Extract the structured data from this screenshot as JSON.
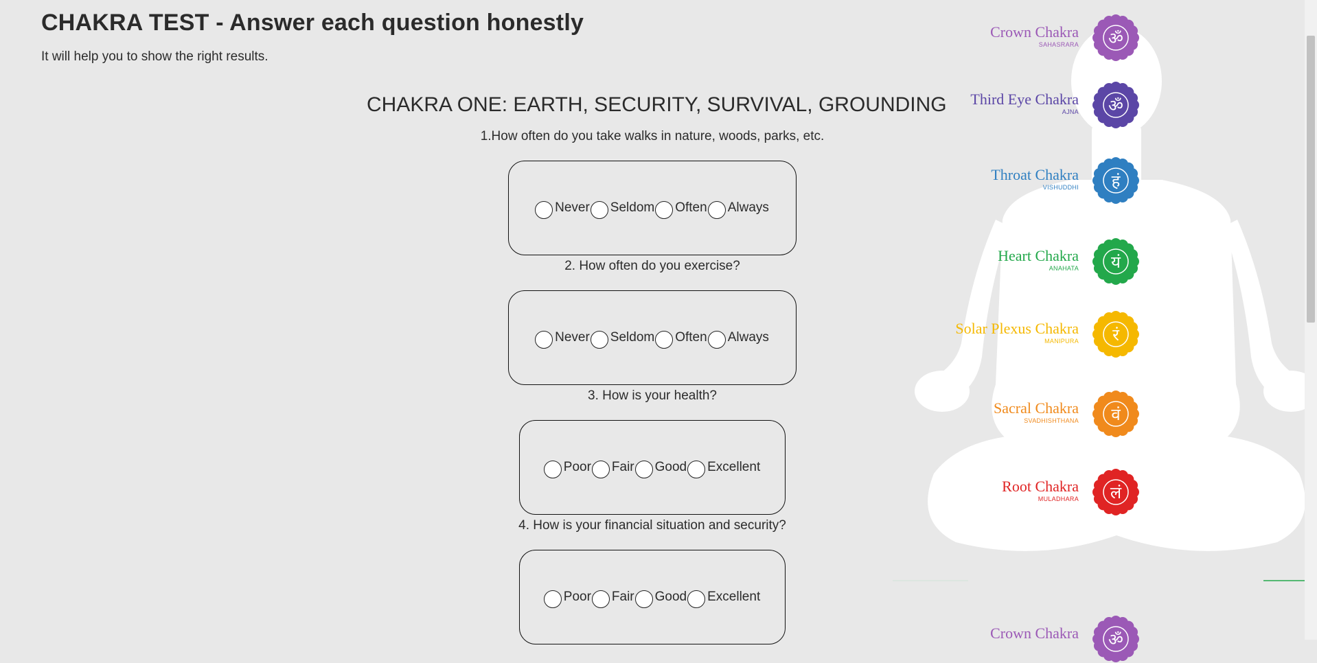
{
  "header": {
    "title": "CHAKRA TEST - Answer each question honestly",
    "subtitle": "It will help you to show the right results."
  },
  "section": {
    "title": "CHAKRA ONE: EARTH, SECURITY, SURVIVAL, GROUNDING"
  },
  "questions": [
    {
      "text": "1.How often do you take walks in nature, woods, parks, etc.",
      "options": [
        "Never",
        "Seldom",
        "Often",
        "Always"
      ]
    },
    {
      "text": "2. How often do you exercise?",
      "options": [
        "Never",
        "Seldom",
        "Often",
        "Always"
      ]
    },
    {
      "text": "3. How is your health?",
      "options": [
        "Poor",
        "Fair",
        "Good",
        "Excellent"
      ]
    },
    {
      "text": "4. How is your financial situation and security?",
      "options": [
        "Poor",
        "Fair",
        "Good",
        "Excellent"
      ]
    }
  ],
  "chakras": [
    {
      "name": "Crown Chakra",
      "sanskrit": "SAHASRARA",
      "color": "#9b59b6",
      "glyph": "ॐ"
    },
    {
      "name": "Third Eye Chakra",
      "sanskrit": "AJNA",
      "color": "#5b46a6",
      "glyph": "ॐ"
    },
    {
      "name": "Throat Chakra",
      "sanskrit": "VISHUDDHI",
      "color": "#2f7fc1",
      "glyph": "हं"
    },
    {
      "name": "Heart Chakra",
      "sanskrit": "ANAHATA",
      "color": "#23a84b",
      "glyph": "यं"
    },
    {
      "name": "Solar Plexus Chakra",
      "sanskrit": "MANIPURA",
      "color": "#f5b800",
      "glyph": "रं"
    },
    {
      "name": "Sacral Chakra",
      "sanskrit": "SVADHISHTHANA",
      "color": "#f08a1c",
      "glyph": "वं"
    },
    {
      "name": "Root Chakra",
      "sanskrit": "MULADHARA",
      "color": "#e02424",
      "glyph": "लं"
    },
    {
      "name": "Crown Chakra",
      "sanskrit": "",
      "color": "#9b59b6",
      "glyph": "ॐ"
    }
  ]
}
